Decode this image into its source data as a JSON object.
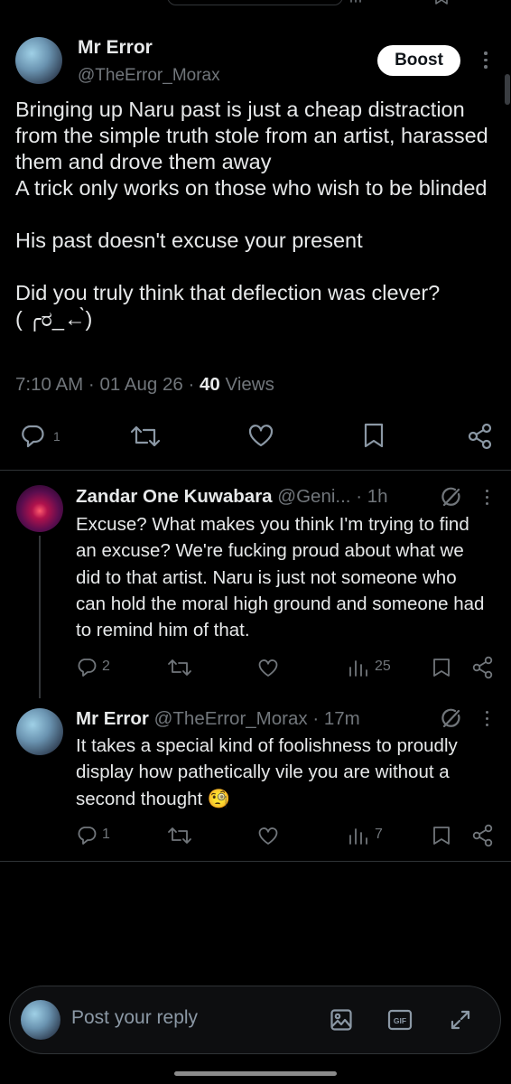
{
  "main_post": {
    "author_name": "Mr Error",
    "author_handle": "@TheError_Morax",
    "boost_label": "Boost",
    "body": "Bringing up Naru past is just a cheap distraction from the simple truth stole from an artist, harassed them and drove them away\nA trick only works on those who wish to be blinded\n\nHis past doesn't excuse your present\n\nDid you truly think that deflection was clever?\n( ╭ರ_←̀)",
    "time": "7:10 AM",
    "date": "01 Aug 26",
    "views_count": "40",
    "views_label": "Views",
    "reply_count": "1"
  },
  "replies": [
    {
      "author_name": "Zandar One Kuwabara",
      "author_handle": "@Geni...",
      "time": "1h",
      "body": "Excuse? What makes you think I'm trying to find an excuse? We're fucking proud about what we did to that artist. Naru is just not someone who can hold the moral high ground and someone had to remind him of that.",
      "reply_count": "2",
      "views_count": "25"
    },
    {
      "author_name": "Mr Error",
      "author_handle": "@TheError_Morax",
      "time": "17m",
      "body": "It takes a special kind of foolishness to proudly display how pathetically vile you are without a second thought 🧐",
      "reply_count": "1",
      "views_count": "7"
    }
  ],
  "composer": {
    "placeholder": "Post your reply"
  },
  "colors": {
    "background": "#000000",
    "text": "#e7e9ea",
    "muted": "#71767b",
    "boost_bg": "#ffffff"
  },
  "icons": [
    "reply-icon",
    "repost-icon",
    "like-icon",
    "bookmark-icon",
    "share-icon",
    "views-icon",
    "grok-icon",
    "more-icon",
    "image-icon",
    "gif-icon",
    "expand-icon"
  ]
}
